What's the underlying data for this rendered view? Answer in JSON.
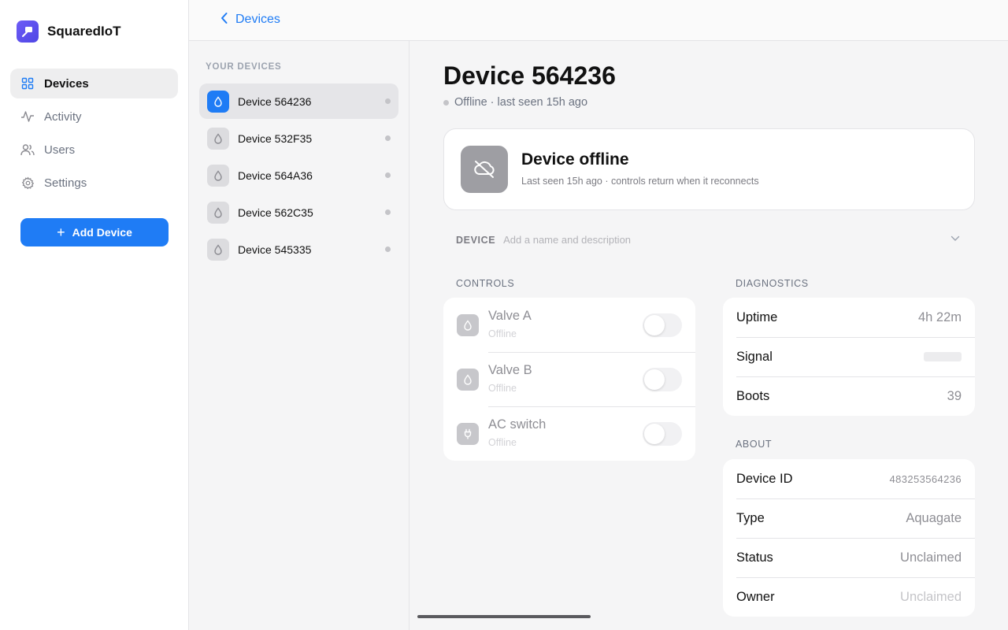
{
  "app": {
    "name": "SquaredIoT"
  },
  "sidebar": {
    "items": [
      {
        "label": "Devices",
        "icon": "grid-icon",
        "active": true
      },
      {
        "label": "Activity",
        "icon": "activity-icon",
        "active": false
      },
      {
        "label": "Users",
        "icon": "users-icon",
        "active": false
      },
      {
        "label": "Settings",
        "icon": "gear-icon",
        "active": false
      }
    ],
    "add_button": "Add Device"
  },
  "topbar": {
    "back_label": "Devices"
  },
  "device_list": {
    "header": "YOUR DEVICES",
    "items": [
      {
        "name": "Device 564236",
        "active": true
      },
      {
        "name": "Device 532F35",
        "active": false
      },
      {
        "name": "Device 564A36",
        "active": false
      },
      {
        "name": "Device 562C35",
        "active": false
      },
      {
        "name": "Device 545335",
        "active": false
      }
    ]
  },
  "detail": {
    "title": "Device 564236",
    "status_line": "Offline · last seen 15h ago",
    "offline_banner": {
      "title": "Device offline",
      "subtitle": "Last seen 15h ago · controls return when it reconnects"
    },
    "device_section": {
      "label": "DEVICE",
      "placeholder": "Add a name and description"
    },
    "controls": {
      "label": "CONTROLS",
      "items": [
        {
          "name": "Valve A",
          "state": "Offline",
          "icon": "droplet-icon",
          "on": false
        },
        {
          "name": "Valve B",
          "state": "Offline",
          "icon": "droplet-icon",
          "on": false
        },
        {
          "name": "AC switch",
          "state": "Offline",
          "icon": "plug-icon",
          "on": false
        }
      ]
    },
    "diagnostics": {
      "label": "DIAGNOSTICS",
      "uptime": {
        "key": "Uptime",
        "value": "4h 22m"
      },
      "signal": {
        "key": "Signal"
      },
      "boots": {
        "key": "Boots",
        "value": "39"
      }
    },
    "about": {
      "label": "ABOUT",
      "rows": [
        {
          "key": "Device ID",
          "value": "483253564236"
        },
        {
          "key": "Type",
          "value": "Aquagate"
        },
        {
          "key": "Status",
          "value": "Unclaimed"
        },
        {
          "key": "Owner",
          "value": "Unclaimed"
        }
      ]
    }
  },
  "colors": {
    "accent": "#1f7cf5",
    "brand": "#5b4ff0",
    "offline_icon_bg": "#9e9ea3"
  }
}
